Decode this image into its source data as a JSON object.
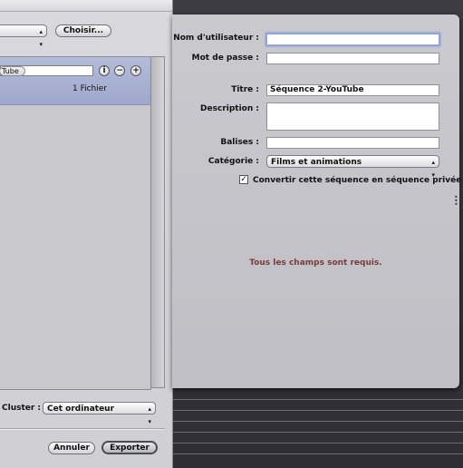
{
  "left_panel": {
    "choose_button": "Choisir...",
    "row_field_value": "Tube",
    "file_count": "1 Fichier",
    "cluster_label": "Cluster :",
    "cluster_value": "Cet ordinateur",
    "cancel_button": "Annuler",
    "export_button": "Exporter"
  },
  "dialog": {
    "username_label": "Nom d'utilisateur :",
    "username_value": "",
    "password_label": "Mot de passe :",
    "password_value": "",
    "title_label": "Titre :",
    "title_value": "Séquence 2-YouTube",
    "description_label": "Description :",
    "description_value": "",
    "tags_label": "Balises :",
    "tags_value": "",
    "category_label": "Catégorie :",
    "category_value": "Films et animations",
    "private_checkbox_label": "Convertir cette séquence en séquence privée",
    "private_checked": true,
    "required_message": "Tous les champs sont requis."
  }
}
